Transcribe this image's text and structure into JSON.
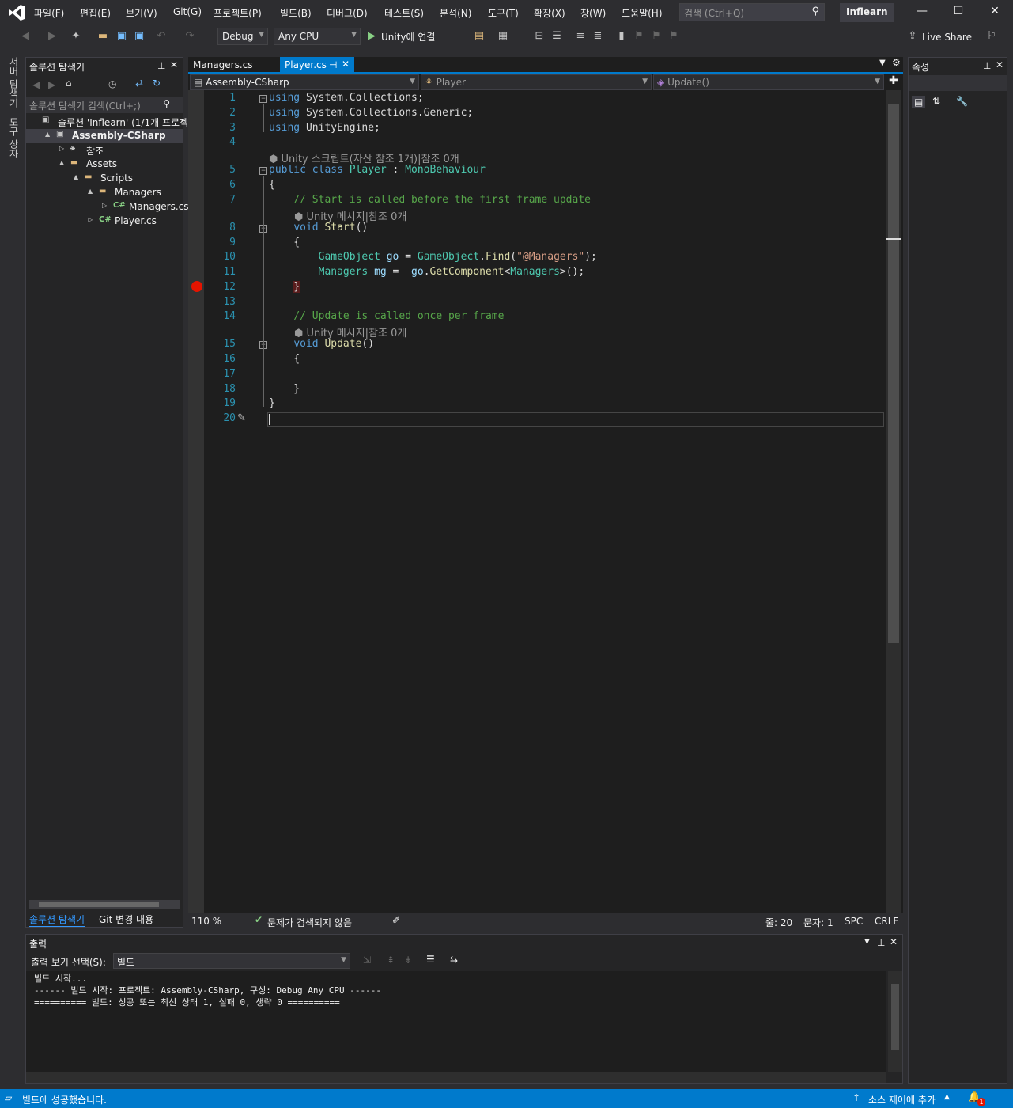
{
  "menu": [
    "파일(F)",
    "편집(E)",
    "보기(V)",
    "Git(G)",
    "프로젝트(P)",
    "빌드(B)",
    "디버그(D)",
    "테스트(S)",
    "분석(N)",
    "도구(T)",
    "확장(X)",
    "창(W)",
    "도움말(H)"
  ],
  "search_placeholder": "검색 (Ctrl+Q)",
  "solution_name": "Inflearn",
  "toolbar": {
    "config": "Debug",
    "platform": "Any CPU",
    "run_label": "Unity에 연결",
    "live_share": "Live Share"
  },
  "side_tabs": [
    "서버 탐색기",
    "도구 상자"
  ],
  "solution_explorer": {
    "title": "솔루션 탐색기",
    "search": "솔루션 탐색기 검색(Ctrl+;)",
    "items": [
      {
        "label": "솔루션 'Inflearn' (1/1개 프로젝트)",
        "indent": 0
      },
      {
        "label": "Assembly-CSharp",
        "indent": 1
      },
      {
        "label": "참조",
        "indent": 2
      },
      {
        "label": "Assets",
        "indent": 2
      },
      {
        "label": "Scripts",
        "indent": 3
      },
      {
        "label": "Managers",
        "indent": 4
      },
      {
        "label": "Managers.cs",
        "indent": 5
      },
      {
        "label": "Player.cs",
        "indent": 4
      }
    ],
    "bottom_tabs": [
      "솔루션 탐색기",
      "Git 변경 내용"
    ]
  },
  "editor": {
    "tabs": [
      "Managers.cs",
      "Player.cs"
    ],
    "active_tab": "Player.cs",
    "nav": [
      "Assembly-CSharp",
      "Player",
      "Update()"
    ],
    "hints": {
      "class": "Unity 스크립트(자산 참조 1개)|참조 0개",
      "start": "Unity 메시지|참조 0개",
      "update": "Unity 메시지|참조 0개"
    },
    "line_numbers": [
      "1",
      "2",
      "3",
      "4",
      "5",
      "6",
      "7",
      "8",
      "9",
      "10",
      "11",
      "12",
      "13",
      "14",
      "15",
      "16",
      "17",
      "18",
      "19",
      "20"
    ]
  },
  "editor_status": {
    "zoom": "110 %",
    "issues": "문제가 검색되지 않음",
    "line": "줄: 20",
    "col": "문자: 1",
    "spc": "SPC",
    "crlf": "CRLF"
  },
  "output": {
    "title": "출력",
    "source_label": "출력 보기 선택(S):",
    "source_value": "빌드",
    "lines": [
      "빌드 시작...",
      "------ 빌드 시작: 프로젝트: Assembly-CSharp, 구성: Debug Any CPU ------",
      "========== 빌드: 성공 또는 최신 상태 1, 실패 0, 생략 0 =========="
    ]
  },
  "properties": {
    "title": "속성"
  },
  "statusbar": {
    "message": "빌드에 성공했습니다.",
    "source_control": "소스 제어에 추가",
    "notif_count": "1"
  }
}
